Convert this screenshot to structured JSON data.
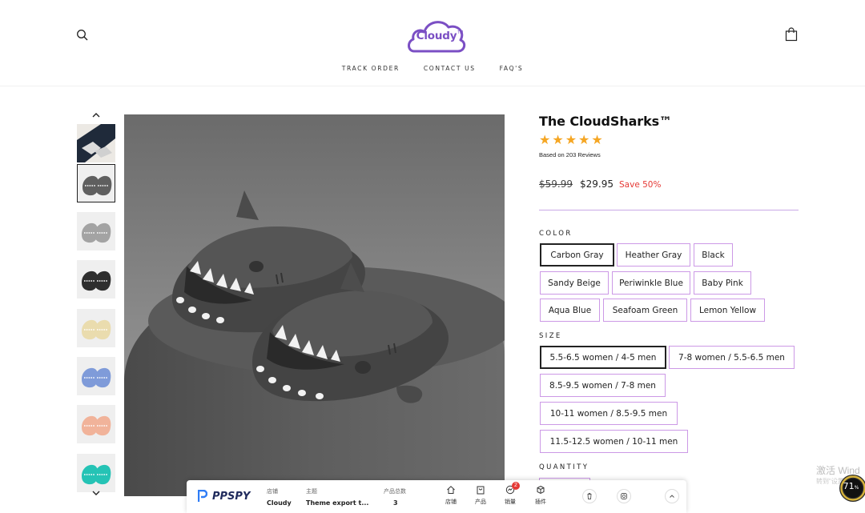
{
  "header": {
    "logo": "Cloudy",
    "logo_tm": "TM",
    "nav": [
      "TRACK ORDER",
      "CONTACT US",
      "FAQ'S"
    ],
    "search_icon": "search-icon",
    "cart_icon": "bag-icon"
  },
  "gallery": {
    "prev_icon": "chevron-up-icon",
    "next_icon": "chevron-down-icon",
    "thumbnails": [
      {
        "color": "#6f7b86",
        "label": "lifestyle"
      },
      {
        "color": "#5f5f5f",
        "label": "carbon-gray",
        "active": true
      },
      {
        "color": "#a3a3a3",
        "label": "heather-gray"
      },
      {
        "color": "#2e2e2e",
        "label": "black"
      },
      {
        "color": "#eadcae",
        "label": "sandy-beige"
      },
      {
        "color": "#7f9bd9",
        "label": "periwinkle-blue"
      },
      {
        "color": "#f1b39a",
        "label": "baby-pink"
      },
      {
        "color": "#25c3b5",
        "label": "aqua-blue"
      }
    ]
  },
  "product": {
    "title": "The CloudSharks™",
    "rating": 5,
    "reviews_text": "Based on 203 Reviews",
    "price_old": "$59.99",
    "price_new": "$29.95",
    "save": "Save 50%",
    "color_label": "COLOR",
    "colors": [
      "Carbon Gray",
      "Heather Gray",
      "Black",
      "Sandy Beige",
      "Periwinkle Blue",
      "Baby Pink",
      "Aqua Blue",
      "Seafoam Green",
      "Lemon Yellow"
    ],
    "selected_color": "Carbon Gray",
    "size_label": "SIZE",
    "sizes": [
      "5.5-6.5 women / 4-5 men",
      "7-8 women / 5.5-6.5 men",
      "8.5-9.5 women / 7-8 men",
      "10-11 women / 8.5-9.5 men",
      "11.5-12.5 women / 10-11 men"
    ],
    "selected_size": "5.5-6.5 women / 4-5 men",
    "quantity_label": "QUANTITY"
  },
  "ppspy": {
    "brand": "PPSPY",
    "store_caption": "店铺",
    "store_value": "Cloudy",
    "theme_caption": "主题",
    "theme_value": "Theme export t...",
    "products_caption": "产品总数",
    "products_value": "3",
    "tools": [
      {
        "label": "店铺",
        "icon": "home-icon"
      },
      {
        "label": "产品",
        "icon": "bag-icon"
      },
      {
        "label": "销量",
        "icon": "sales-icon",
        "badge": "2"
      },
      {
        "label": "插件",
        "icon": "cube-icon"
      }
    ],
    "social": [
      "shopify-icon",
      "instagram-icon"
    ],
    "collapse_icon": "chevron-up-icon"
  },
  "windows": {
    "watermark_1": "激活 Wind",
    "watermark_2": "转到\"设置\"以",
    "gauge_value": "71",
    "gauge_unit": "%"
  }
}
